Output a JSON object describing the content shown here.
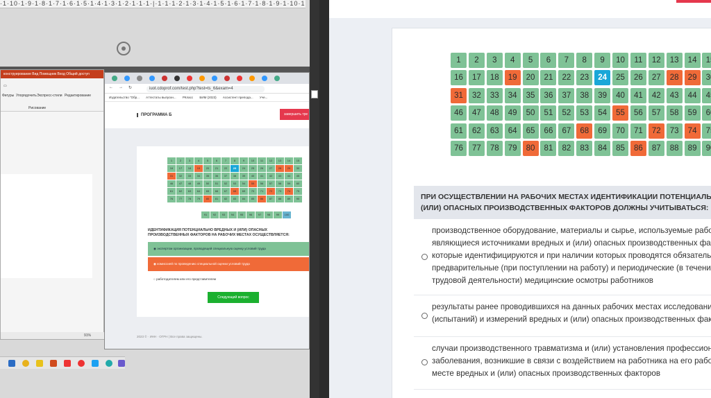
{
  "ruler_text": "·1·10·1·9·1·8·1·7·1·6·1·5·1·4·1·3·1·2·1·1·1·|·1·1·1·2·1·3·1·4·1·5·1·6·1·7·1·8·1·9·1·10·1·11·1·12·1·13·1·14·1·15·1·16·",
  "ppt": {
    "title_text": "конструирование   Вид   Помощник   Вход   Общий доступ",
    "ribbon": {
      "shapes": "Фигуры",
      "arrange": "Упорядочить",
      "quick_styles": "Экспресс-стили",
      "editing": "Редактирование",
      "group_label": "Рисование"
    },
    "status_zoom": "91%"
  },
  "browser": {
    "url": "iuot.cdoprof.com/test.php?test=ts_6&exam=4",
    "bookmarks": [
      "Издательство \"Обр...",
      "Аттестаты выпускн...",
      "РКласс",
      "БИМ (2023)",
      "Ассистент препода...",
      "Уче..."
    ],
    "program_title": "ПРОГРАММА Б",
    "finish_label": "завершить тре",
    "question": "ИДЕНТИФИКАЦИЯ ПОТЕНЦИАЛЬНО ВРЕДНЫХ И (ИЛИ) ОПАСНЫХ ПРОИЗВОДСТВЕННЫХ ФАКТОРОВ НА РАБОЧИХ МЕСТАХ ОСУЩЕСТВЛЯЕТСЯ:",
    "options": [
      "экспертом организации, проводящей специальную оценку условий труда",
      "комиссией по проведению специальной оценки условий труда",
      "работодателем или его представителем"
    ],
    "next_label": "Следующий вопрос",
    "footer": "2023 ©  · ИНН · ОГРН | Все права защищены."
  },
  "main": {
    "question": "ПРИ ОСУЩЕСТВЛЕНИИ НА РАБОЧИХ МЕСТАХ ИДЕНТИФИКАЦИИ ПОТЕНЦИАЛЬНО ВР\n(ИЛИ) ОПАСНЫХ ПРОИЗВОДСТВЕННЫХ ФАКТОРОВ ДОЛЖНЫ УЧИТЫВАТЬСЯ:",
    "options": [
      "производственное оборудование, материалы и сырье, используемые работ\nявляющиеся источниками вредных и (или) опасных производственных фак\nкоторые идентифицируются и при наличии которых проводятся обязатель\nпредварительные (при поступлении на работу) и периодические (в течение\nтрудовой деятельности) медицинские осмотры работников",
      "результаты ранее проводившихся на данных рабочих местах исследований\n(испытаний) и измерений вредных и (или) опасных производственных фак",
      "случаи производственного травматизма и (или) установления профессион\nзаболевания, возникшие в связи с воздействием на работника на его рабо\nместе вредных и (или) опасных производственных факторов"
    ]
  },
  "navigator": {
    "total": 100,
    "current": 24,
    "wrong": [
      19,
      28,
      29,
      31,
      55,
      68,
      72,
      74,
      80,
      86
    ],
    "mini_current": 23,
    "mini_wrong": [
      19,
      28,
      29,
      31,
      55,
      68,
      72,
      74,
      80,
      86
    ],
    "colors": {
      "correct": "#7fc296",
      "wrong": "#f06a38",
      "current": "#1aa7d8",
      "unanswered": "#68b4d0"
    }
  }
}
